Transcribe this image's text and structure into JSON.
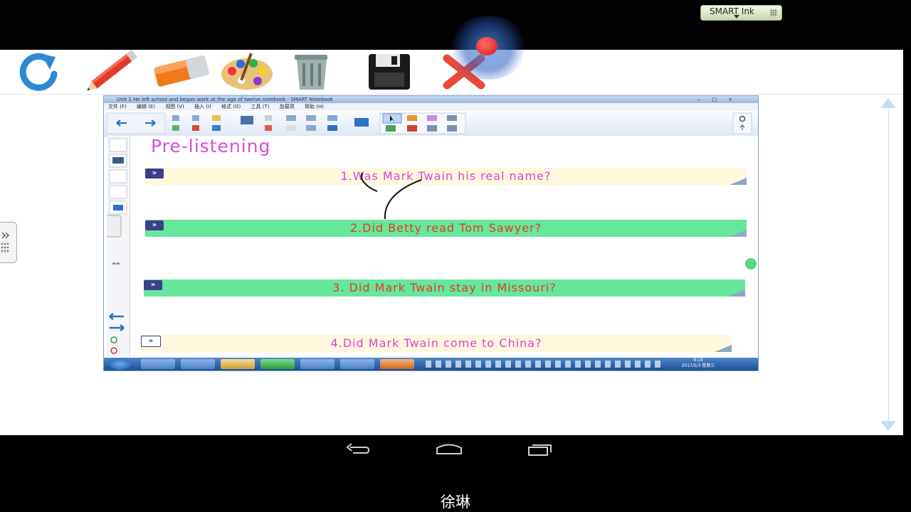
{
  "system": {
    "smart_ink_label": "SMART Ink",
    "caption": "徐琳"
  },
  "toolbar": {
    "tools": [
      {
        "name": "refresh-icon"
      },
      {
        "name": "pen-icon"
      },
      {
        "name": "eraser-icon"
      },
      {
        "name": "palette-icon"
      },
      {
        "name": "trash-icon"
      },
      {
        "name": "save-icon"
      },
      {
        "name": "close-icon"
      }
    ]
  },
  "window": {
    "title": "Unit 1 He left school and began work at the age of twelve.notebook - SMART Notebook",
    "menu": [
      "文件 (F)",
      "编辑 (E)",
      "视图 (V)",
      "插入 (I)",
      "格式 (O)",
      "工具 (T)",
      "加载项",
      "帮助 (H)"
    ],
    "clock_time": "9:14",
    "clock_date": "2017/5/3 星期三"
  },
  "slide": {
    "heading": "Pre-listening",
    "questions": [
      {
        "text": "1.Was Mark Twain his real name?",
        "text_color": "#e040d0",
        "bar_color": "#fff8dc"
      },
      {
        "text": "2.Did Betty read Tom  Sawyer?",
        "text_color": "#e83a1c",
        "bar_color": "#66e79c"
      },
      {
        "text": "3. Did Mark Twain stay in Missouri?",
        "text_color": "#e83a1c",
        "bar_color": "#66e79c"
      },
      {
        "text": "4.Did Mark Twain come to China?",
        "text_color": "#e040d0",
        "bar_color": "#fff8dc"
      }
    ]
  },
  "colors": {
    "heading": "#d64fd6",
    "accent": "#3b3f8c"
  }
}
